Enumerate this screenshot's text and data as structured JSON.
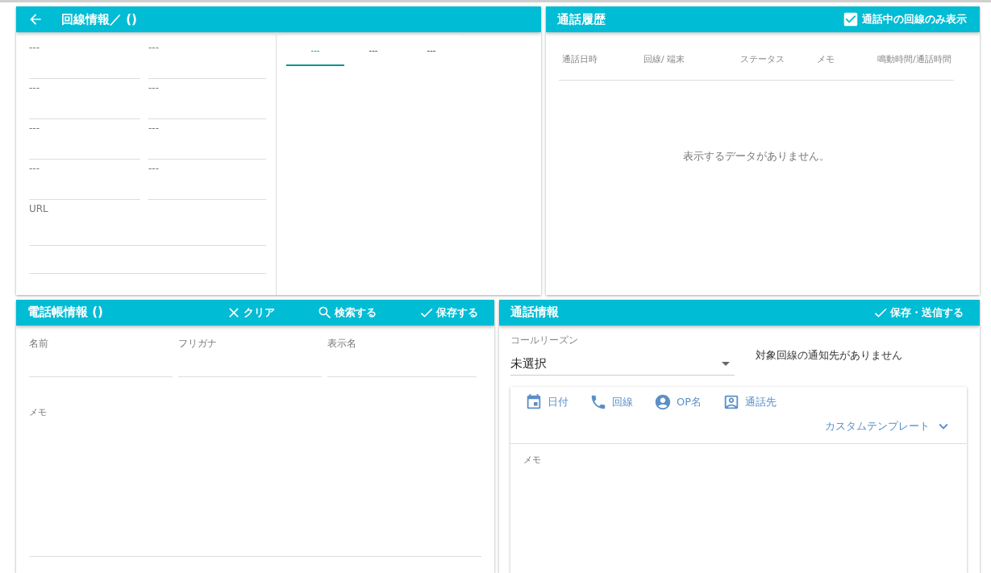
{
  "line_info": {
    "title": "回線情報／ ()",
    "fields": [
      {
        "label": "---"
      },
      {
        "label": "---"
      },
      {
        "label": "---"
      },
      {
        "label": "---"
      },
      {
        "label": "---"
      },
      {
        "label": "---"
      },
      {
        "label": "---"
      },
      {
        "label": "---"
      }
    ],
    "url_label": "URL",
    "tabs": [
      {
        "label": "---",
        "selected": true
      },
      {
        "label": "---",
        "selected": false
      },
      {
        "label": "---",
        "selected": false
      }
    ]
  },
  "call_history": {
    "title": "通話履歴",
    "filter": {
      "label": "通話中の回線のみ表示",
      "checked": true
    },
    "columns": [
      "通話日時",
      "回線/ 端末",
      "ステータス",
      "メモ",
      "鳴動時間/通話時間"
    ],
    "empty_message": "表示するデータがありません。"
  },
  "phonebook": {
    "title": "電話帳情報 ()",
    "actions": [
      {
        "label": "クリア",
        "kind": "clear"
      },
      {
        "label": "検索する",
        "kind": "search"
      },
      {
        "label": "保存する",
        "kind": "save"
      }
    ],
    "fields": [
      {
        "label": "名前"
      },
      {
        "label": "フリガナ"
      },
      {
        "label": "表示名"
      }
    ],
    "memo_label": "メモ"
  },
  "call_info": {
    "title": "通話情報",
    "action": {
      "label": "保存・送信する",
      "kind": "save"
    },
    "call_reason": {
      "label": "コールリーズン",
      "value": "未選択"
    },
    "notice": "対象回線の通知先がありません",
    "template_buttons": [
      {
        "label": "日付",
        "kind": "date"
      },
      {
        "label": "回線",
        "kind": "line"
      },
      {
        "label": "OP名",
        "kind": "operator"
      },
      {
        "label": "通話先",
        "kind": "contact"
      }
    ],
    "custom_template": "カスタムテンプレート",
    "memo_label": "メモ"
  }
}
